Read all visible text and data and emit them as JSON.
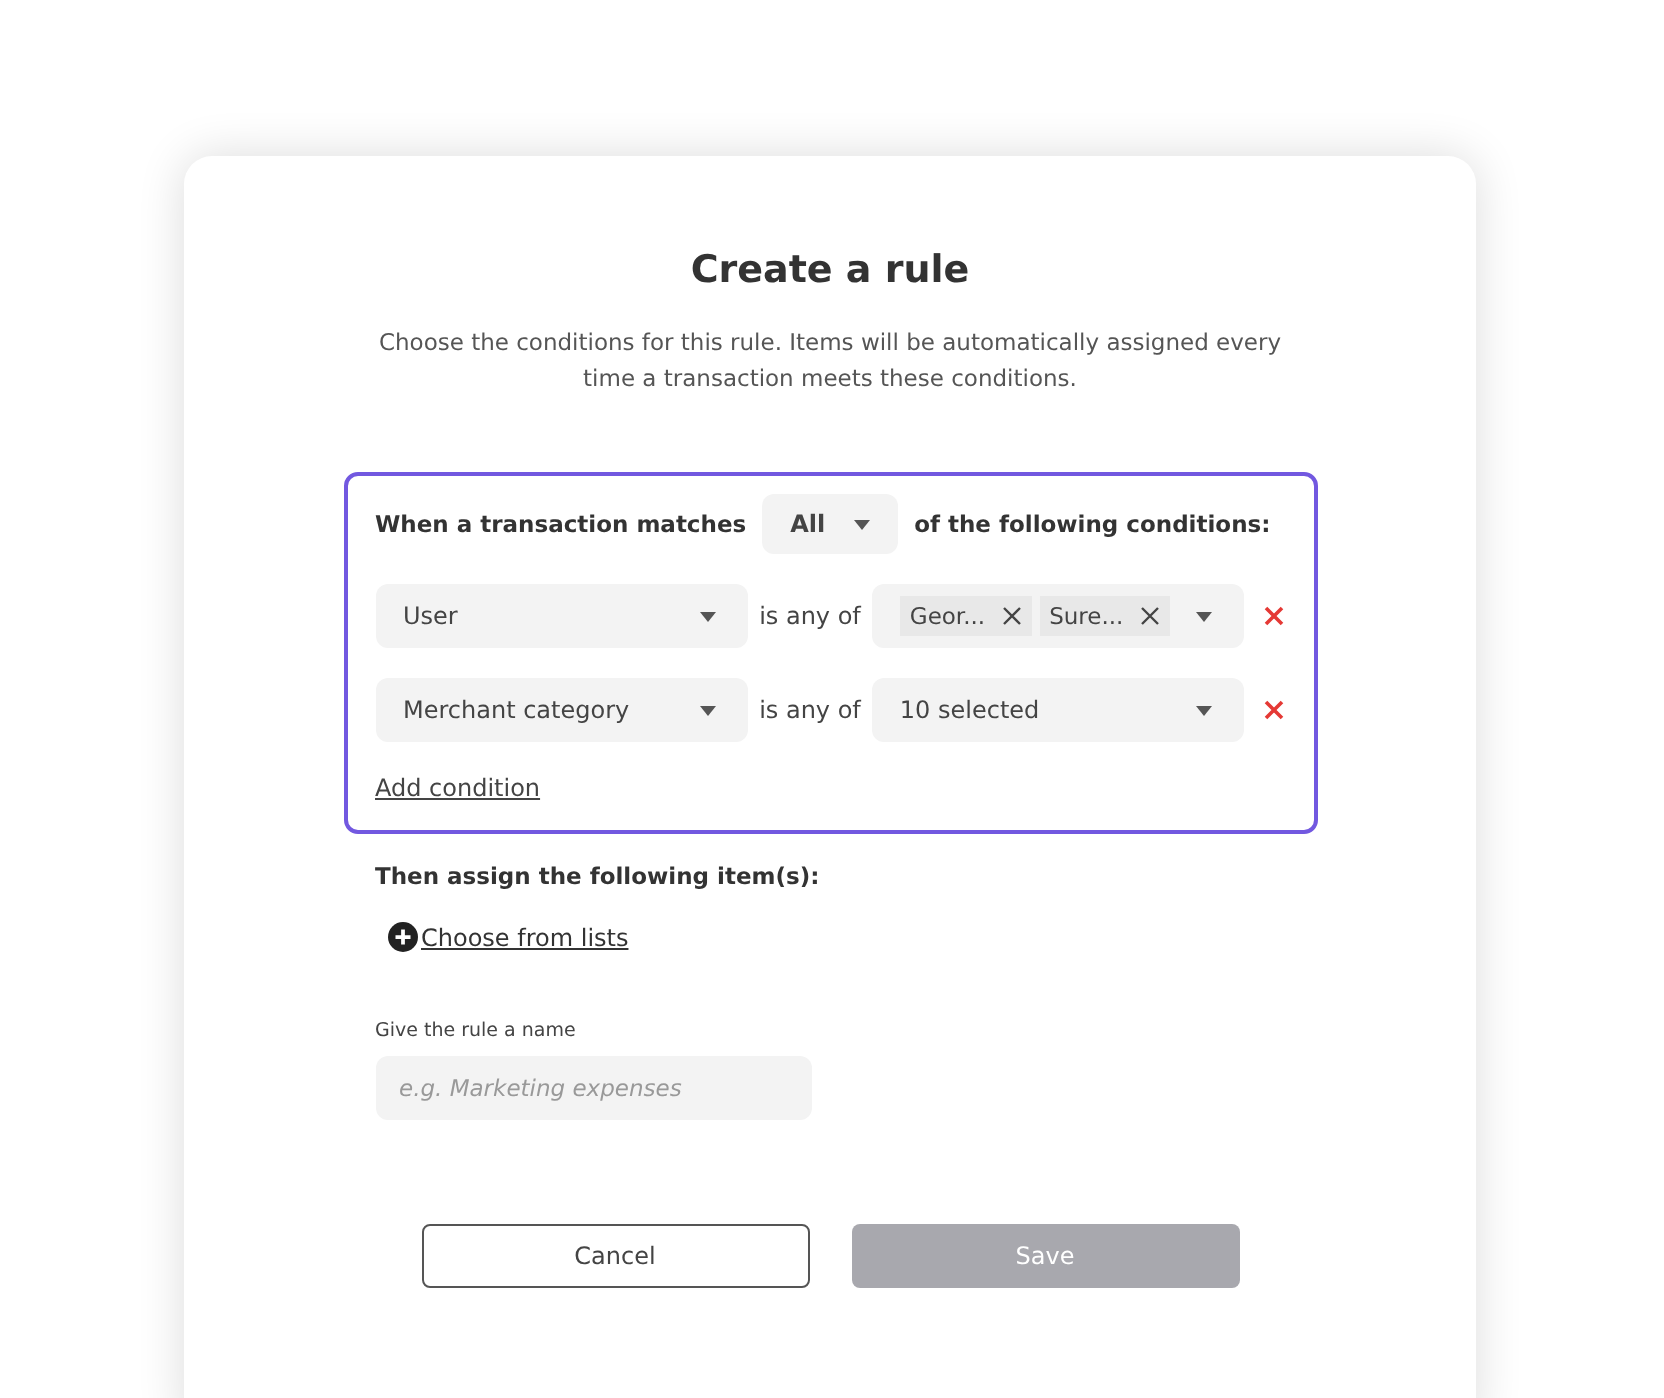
{
  "dialog": {
    "title": "Create a rule",
    "description": "Choose the conditions for this rule. Items will be automatically assigned every time a transaction meets these conditions."
  },
  "conditions_block": {
    "prefix": "When a transaction matches",
    "match": "All",
    "suffix": "of the following conditions:",
    "conditions": [
      {
        "field": "User",
        "operator": "is any of",
        "chips": [
          "Geor...",
          "Sure..."
        ]
      },
      {
        "field": "Merchant category",
        "operator": "is any of",
        "value": "10 selected"
      }
    ],
    "add_link": "Add condition"
  },
  "assign": {
    "heading": "Then assign the following item(s):",
    "link": "Choose from lists"
  },
  "name_field": {
    "label": "Give the rule a name",
    "placeholder": "e.g. Marketing expenses"
  },
  "buttons": [
    {
      "label": "Cancel",
      "kind": "secondary",
      "disabled": false
    },
    {
      "label": "Save",
      "kind": "primary",
      "disabled": true
    }
  ]
}
